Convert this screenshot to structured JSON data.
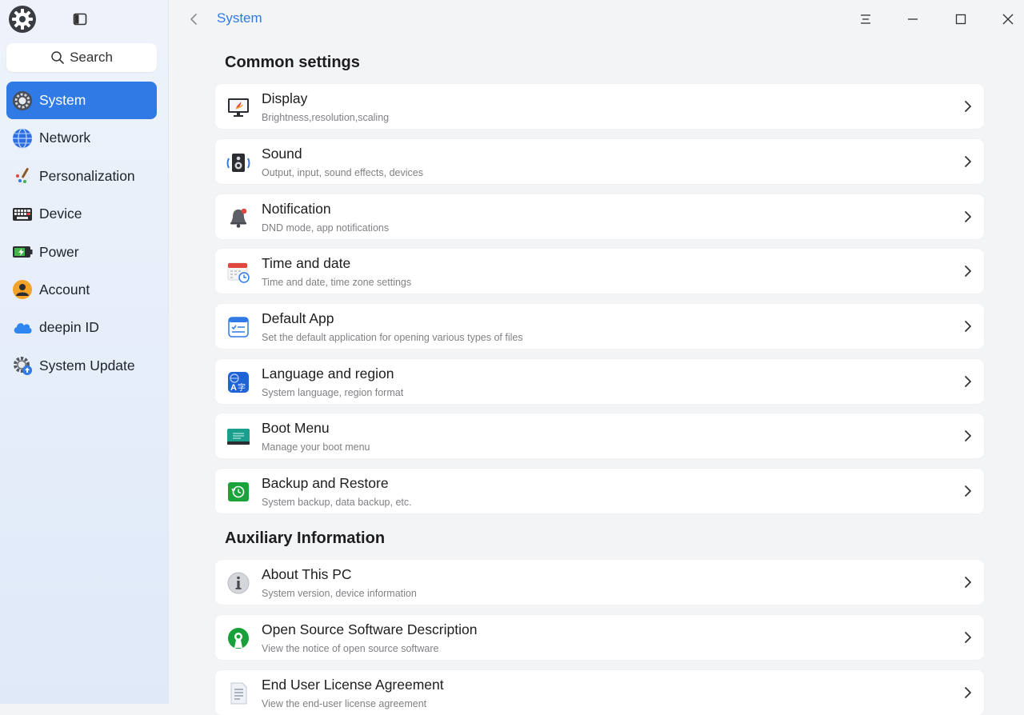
{
  "sidebar": {
    "search_label": "Search",
    "items": [
      {
        "label": "System",
        "icon": "system-icon",
        "active": true
      },
      {
        "label": "Network",
        "icon": "network-globe-icon"
      },
      {
        "label": "Personalization",
        "icon": "palette-brush-icon"
      },
      {
        "label": "Device",
        "icon": "keyboard-device-icon"
      },
      {
        "label": "Power",
        "icon": "battery-power-icon"
      },
      {
        "label": "Account",
        "icon": "user-account-icon"
      },
      {
        "label": "deepin ID",
        "icon": "cloud-icon"
      },
      {
        "label": "System Update",
        "icon": "update-gear-icon"
      }
    ]
  },
  "header": {
    "breadcrumb": "System"
  },
  "sections": {
    "common": {
      "title": "Common settings",
      "items": [
        {
          "title": "Display",
          "subtitle": "Brightness,resolution,scaling",
          "icon": "display-monitor-icon"
        },
        {
          "title": "Sound",
          "subtitle": "Output, input, sound effects, devices",
          "icon": "speaker-icon"
        },
        {
          "title": "Notification",
          "subtitle": "DND mode, app notifications",
          "icon": "bell-icon"
        },
        {
          "title": "Time and date",
          "subtitle": "Time and date, time zone settings",
          "icon": "calendar-clock-icon"
        },
        {
          "title": "Default App",
          "subtitle": "Set the default application for opening various types of files",
          "icon": "default-app-list-icon"
        },
        {
          "title": "Language and region",
          "subtitle": "System language, region format",
          "icon": "language-icon"
        },
        {
          "title": "Boot Menu",
          "subtitle": "Manage your boot menu",
          "icon": "boot-menu-icon"
        },
        {
          "title": "Backup and Restore",
          "subtitle": "System backup, data backup, etc.",
          "icon": "backup-restore-icon"
        }
      ]
    },
    "auxiliary": {
      "title": "Auxiliary Information",
      "items": [
        {
          "title": "About This PC",
          "subtitle": "System version, device information",
          "icon": "info-icon"
        },
        {
          "title": "Open Source Software Description",
          "subtitle": "View the notice of open source software",
          "icon": "open-source-icon"
        },
        {
          "title": "End User License Agreement",
          "subtitle": "View the end-user license agreement",
          "icon": "license-document-icon"
        }
      ]
    }
  },
  "colors": {
    "accent": "#2f7ae5",
    "sidebar_top": "#eef3fb",
    "sidebar_bottom": "#dfe9f8",
    "page_bg": "#f3f4f6"
  }
}
